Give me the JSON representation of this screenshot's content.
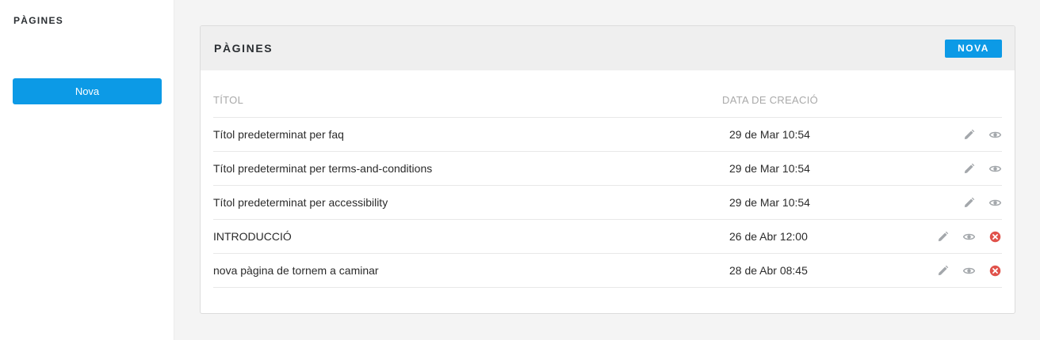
{
  "sidebar": {
    "title": "PÀGINES",
    "new_button_label": "Nova"
  },
  "panel": {
    "title": "PÀGINES",
    "new_button_label": "NOVA"
  },
  "table": {
    "columns": [
      "TÍTOL",
      "DATA DE CREACIÓ"
    ],
    "rows": [
      {
        "title": "Títol predeterminat per faq",
        "date": "29 de Mar 10:54",
        "actions": [
          "pencil-icon",
          "eye-icon"
        ]
      },
      {
        "title": "Títol predeterminat per terms-and-conditions",
        "date": "29 de Mar 10:54",
        "actions": [
          "pencil-icon",
          "eye-icon"
        ]
      },
      {
        "title": "Títol predeterminat per accessibility",
        "date": "29 de Mar 10:54",
        "actions": [
          "pencil-icon",
          "eye-icon"
        ]
      },
      {
        "title": "INTRODUCCIÓ",
        "date": "26 de Abr 12:00",
        "actions": [
          "pencil-icon",
          "eye-icon",
          "delete-icon"
        ]
      },
      {
        "title": "nova pàgina de tornem a caminar",
        "date": "28 de Abr 08:45",
        "actions": [
          "pencil-icon",
          "eye-icon",
          "delete-icon"
        ]
      }
    ]
  },
  "colors": {
    "accent": "#0c9ae6",
    "icon_gray": "#a3a7ab",
    "delete_red": "#e0524b"
  }
}
